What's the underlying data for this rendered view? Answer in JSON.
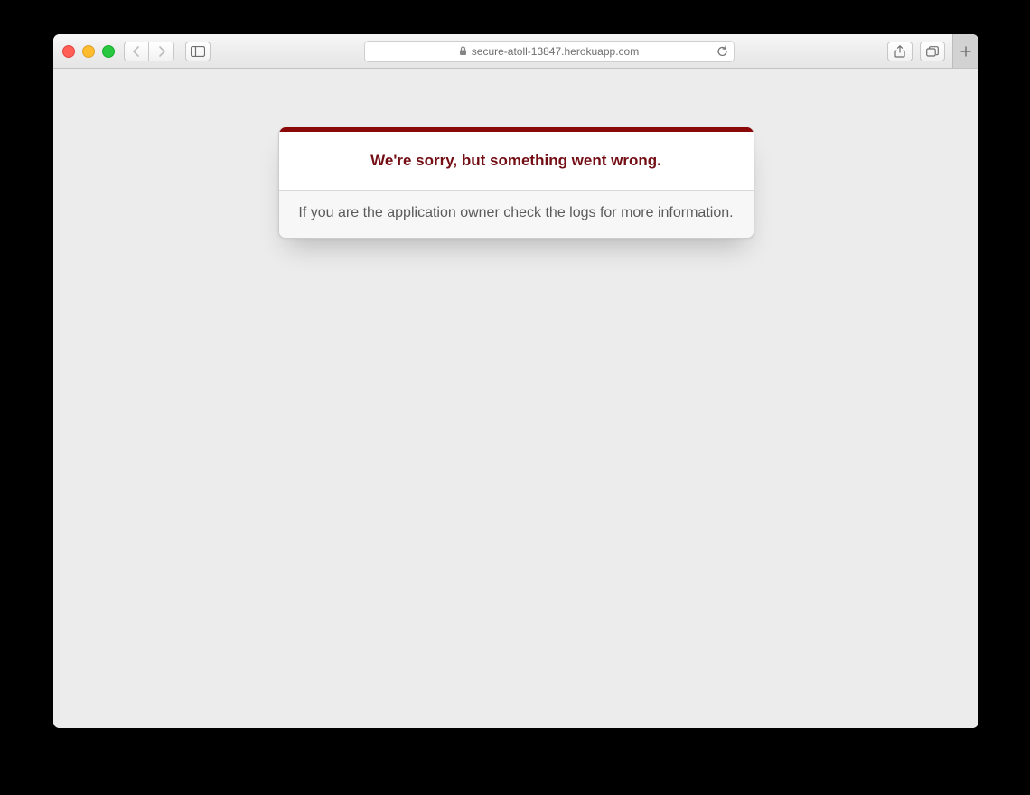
{
  "browser": {
    "url": "secure-atoll-13847.herokuapp.com"
  },
  "page": {
    "error_title": "We're sorry, but something went wrong.",
    "error_body": "If you are the application owner check the logs for more information."
  },
  "colors": {
    "accent": "#8a0808",
    "heading": "#730e15"
  }
}
